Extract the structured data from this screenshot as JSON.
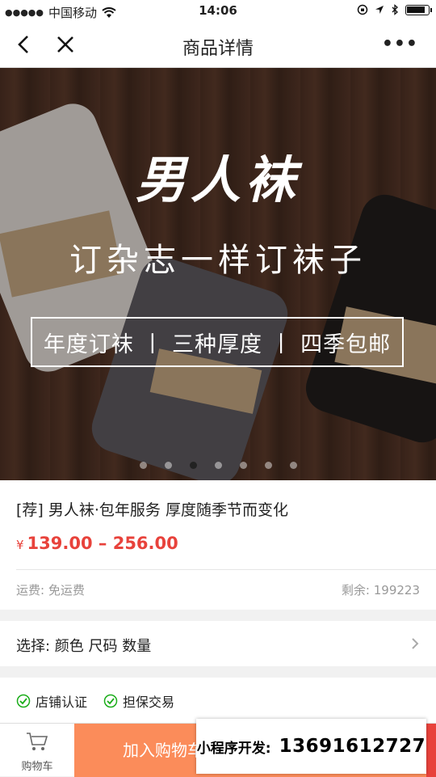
{
  "status_bar": {
    "carrier": "中国移动",
    "time": "14:06"
  },
  "nav": {
    "title": "商品详情",
    "more_label": "•••"
  },
  "banner": {
    "brand_text": "男人袜",
    "slogan": "订杂志一样订袜子",
    "tags": "年度订袜 丨 三种厚度 丨 四季包邮",
    "slide_count": 7,
    "active_slide": 3
  },
  "product": {
    "title": "[荐] 男人袜·包年服务 厚度随季节而变化",
    "currency": "¥",
    "price": "139.00 – 256.00",
    "shipping": "运费: 免运费",
    "stock": "剩余: 199223"
  },
  "select": {
    "label": "选择: 颜色 尺码 数量"
  },
  "guarantees": [
    "店铺认证",
    "担保交易"
  ],
  "bottom": {
    "cart_label": "购物车",
    "add_to_cart": "加入购物车"
  },
  "promo": {
    "label": "小程序开发:",
    "phone": "13691612727"
  },
  "colors": {
    "price_red": "#e8423b",
    "add_cart_orange": "#fb8c5a",
    "check_green": "#1aad19"
  }
}
